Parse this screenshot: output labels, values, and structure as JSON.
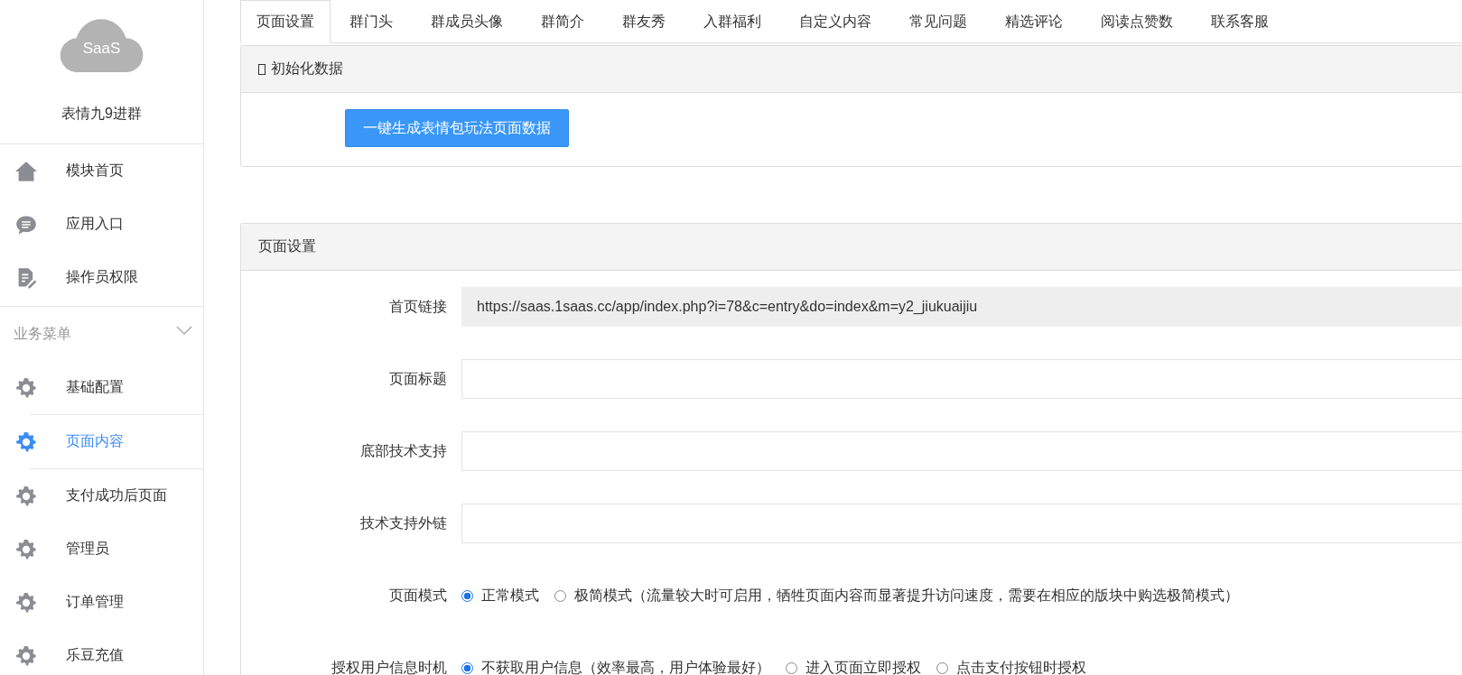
{
  "sidebar": {
    "logo_text": "SaaS",
    "app_name": "表情九9进群",
    "top_items": [
      {
        "label": "模块首页"
      },
      {
        "label": "应用入口"
      },
      {
        "label": "操作员权限"
      }
    ],
    "section": {
      "title": "业务菜单",
      "expanded": true
    },
    "menu_items": [
      {
        "label": "基础配置",
        "selected": false
      },
      {
        "label": "页面内容",
        "selected": true
      },
      {
        "label": "支付成功后页面",
        "selected": false
      },
      {
        "label": "管理员",
        "selected": false
      },
      {
        "label": "订单管理",
        "selected": false
      },
      {
        "label": "乐豆充值",
        "selected": false
      }
    ]
  },
  "tabs": [
    {
      "label": "页面设置",
      "selected": true
    },
    {
      "label": "群门头",
      "selected": false
    },
    {
      "label": "群成员头像",
      "selected": false
    },
    {
      "label": "群简介",
      "selected": false
    },
    {
      "label": "群友秀",
      "selected": false
    },
    {
      "label": "入群福利",
      "selected": false
    },
    {
      "label": "自定义内容",
      "selected": false
    },
    {
      "label": "常见问题",
      "selected": false
    },
    {
      "label": "精选评论",
      "selected": false
    },
    {
      "label": "阅读点赞数",
      "selected": false
    },
    {
      "label": "联系客服",
      "selected": false
    }
  ],
  "init_panel": {
    "title": "初始化数据",
    "button": "一键生成表情包玩法页面数据"
  },
  "settings_panel": {
    "title": "页面设置",
    "fields": [
      {
        "kind": "readonly",
        "label": "首页链接",
        "value": "https://saas.1saas.cc/app/index.php?i=78&c=entry&do=index&m=y2_jiukuaijiu"
      },
      {
        "kind": "text",
        "label": "页面标题"
      },
      {
        "kind": "text",
        "label": "底部技术支持"
      },
      {
        "kind": "text",
        "label": "技术支持外链"
      },
      {
        "kind": "radio",
        "label": "页面模式",
        "options": [
          {
            "label": "正常模式",
            "selected": true
          },
          {
            "label": "极简模式（流量较大时可启用，牺牲页面内容而显著提升访问速度，需要在相应的版块中购选极简模式）",
            "selected": false
          }
        ]
      },
      {
        "kind": "radio",
        "label": "授权用户信息时机",
        "options": [
          {
            "label": "不获取用户信息（效率最高，用户体验最好）",
            "selected": true
          },
          {
            "label": "进入页面立即授权",
            "selected": false
          },
          {
            "label": "点击支付按钮时授权",
            "selected": false
          }
        ]
      }
    ]
  }
}
